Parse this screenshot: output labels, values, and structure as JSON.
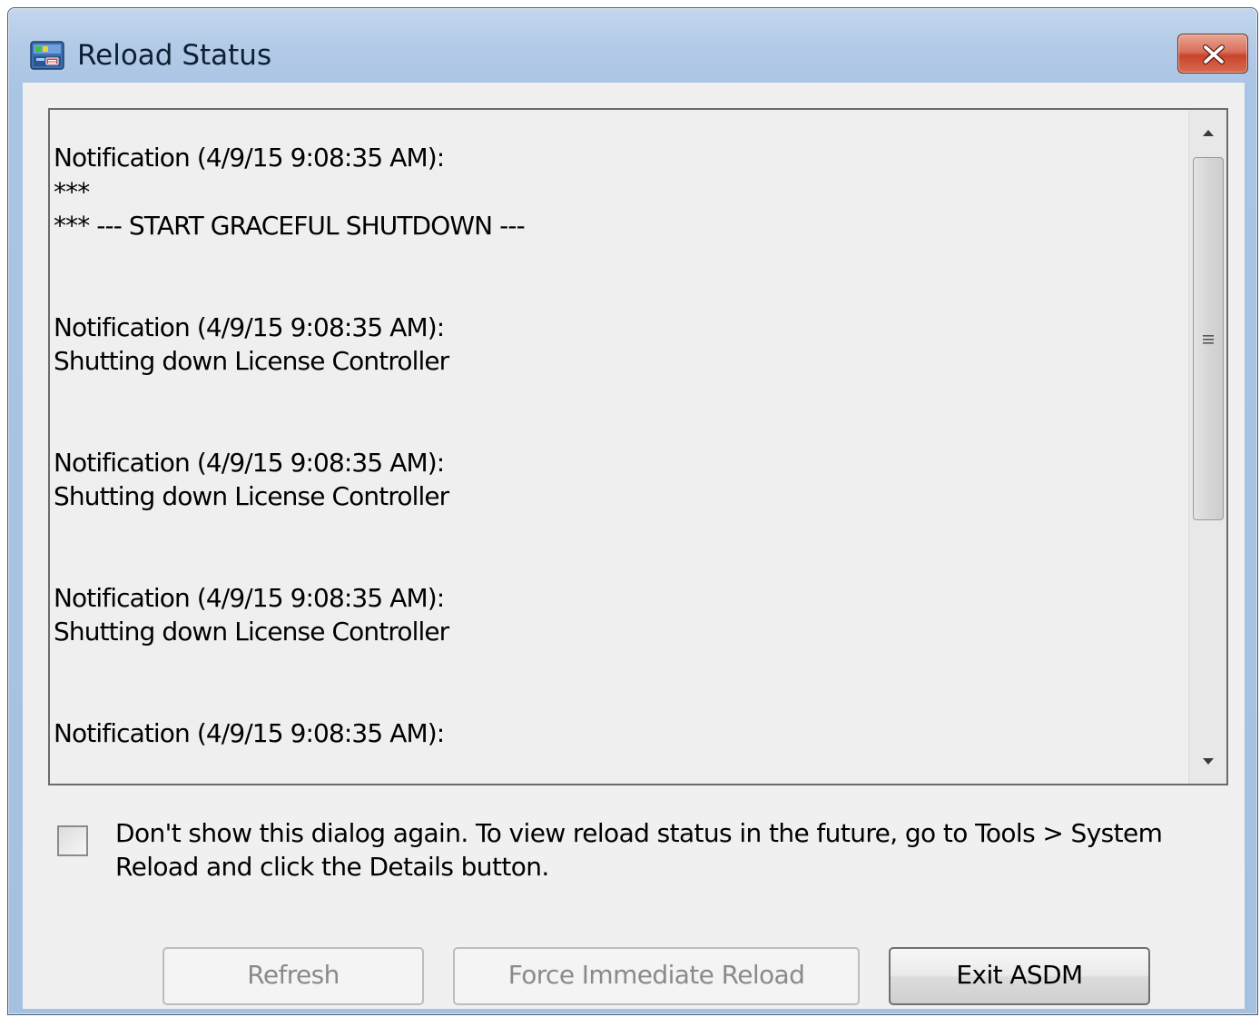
{
  "window": {
    "title": "Reload Status",
    "app_icon": "asdm-app-icon",
    "close_icon": "close-icon"
  },
  "log": {
    "entries": [
      {
        "header": "Notification (4/9/15 9:08:35 AM):",
        "lines": [
          "***",
          "*** --- START GRACEFUL SHUTDOWN ---"
        ]
      },
      {
        "header": "Notification (4/9/15 9:08:35 AM):",
        "lines": [
          "Shutting down License Controller"
        ]
      },
      {
        "header": "Notification (4/9/15 9:08:35 AM):",
        "lines": [
          "Shutting down License Controller"
        ]
      },
      {
        "header": "Notification (4/9/15 9:08:35 AM):",
        "lines": [
          "Shutting down License Controller"
        ]
      },
      {
        "header": "Notification (4/9/15 9:08:35 AM):",
        "lines": []
      }
    ]
  },
  "notice": {
    "checked": false,
    "text_line1": "Don't show this dialog again. To view reload status in the future, go to Tools > System",
    "text_line2": "Reload and click the Details button."
  },
  "buttons": {
    "refresh": "Refresh",
    "force_reload": "Force Immediate Reload",
    "exit": "Exit ASDM"
  }
}
